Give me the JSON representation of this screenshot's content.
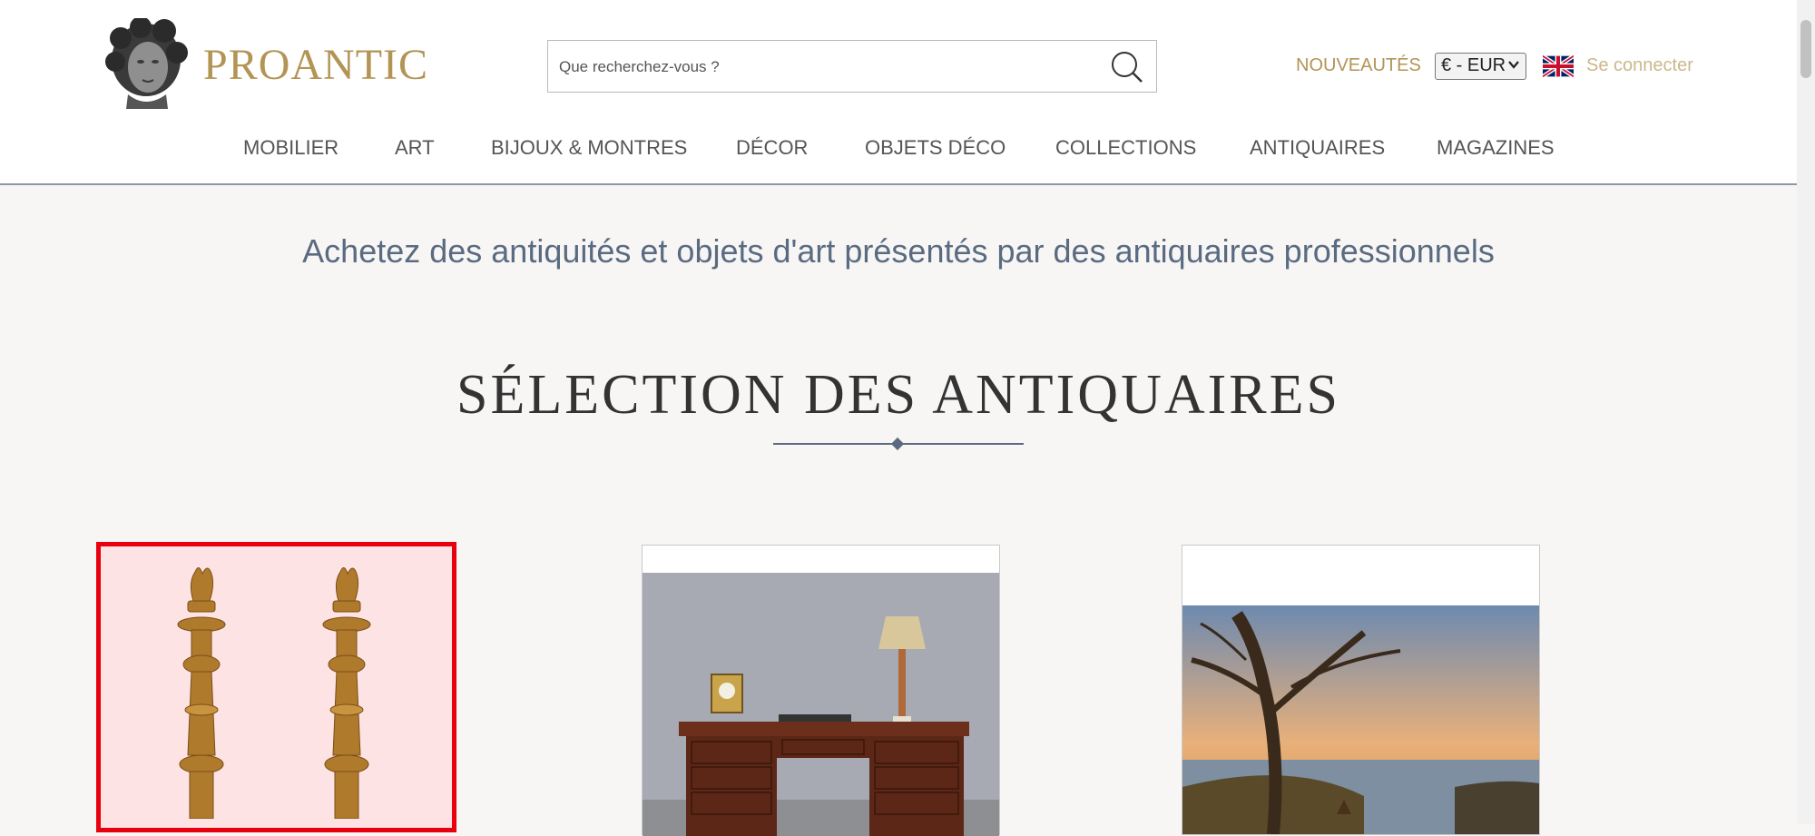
{
  "header": {
    "logo_text": "PROANTIC",
    "search_placeholder": "Que recherchez-vous ?",
    "nouveautes": "NOUVEAUTÉS",
    "currency": "€ - EUR",
    "login": "Se connecter",
    "nav": [
      "MOBILIER",
      "ART",
      "BIJOUX & MONTRES",
      "DÉCOR",
      "OBJETS DÉCO",
      "COLLECTIONS",
      "ANTIQUAIRES",
      "MAGAZINES"
    ]
  },
  "main": {
    "tagline": "Achetez des antiquités et objets d'art présentés par des antiquaires professionnels",
    "section_title": "SÉLECTION DES ANTIQUAIRES"
  },
  "colors": {
    "brand_gold": "#b39455",
    "tagline_blue": "#5a6b81",
    "highlight_red": "#e8000e"
  },
  "icons": [
    "search-icon",
    "chevron-down-icon",
    "uk-flag-icon"
  ]
}
